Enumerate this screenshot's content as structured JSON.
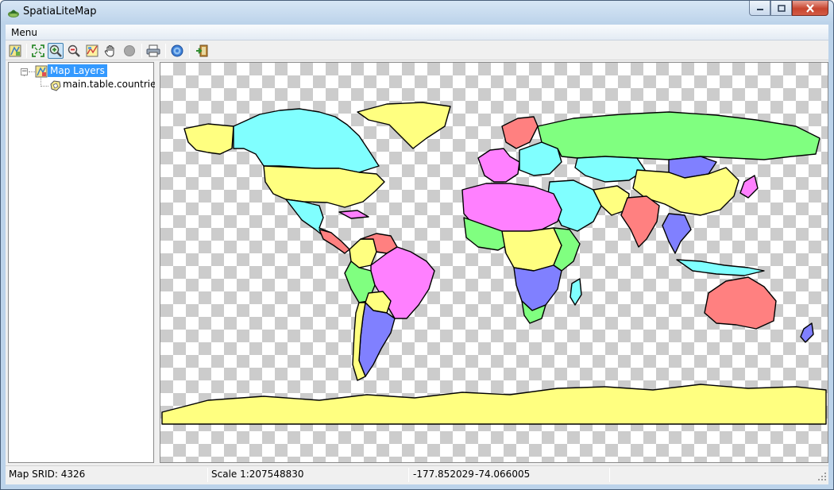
{
  "window": {
    "title": "SpatiaLiteMap"
  },
  "menubar": {
    "menu_label": "Menu"
  },
  "toolbar": {
    "buttons": [
      {
        "icon": "layers-icon"
      },
      {
        "icon": "zoom-extent-icon"
      },
      {
        "icon": "zoom-in-icon",
        "active": true
      },
      {
        "icon": "zoom-out-icon"
      },
      {
        "icon": "map-icon"
      },
      {
        "icon": "pan-hand-icon"
      },
      {
        "icon": "stop-icon"
      },
      {
        "icon": "print-icon"
      },
      {
        "icon": "help-icon"
      },
      {
        "icon": "exit-icon"
      }
    ]
  },
  "tree": {
    "root_label": "Map Layers",
    "child_label": "main.table.countries"
  },
  "statusbar": {
    "srid": "Map SRID: 4326",
    "scale": "Scale 1:207548830",
    "coord_x": "-177.852029",
    "coord_y": "-74.066005"
  },
  "colors": {
    "selection": "#3399ff",
    "fill_yellow": "#ffff80",
    "fill_cyan": "#80ffff",
    "fill_green": "#80ff80",
    "fill_magenta": "#ff80ff",
    "fill_blue": "#8080ff",
    "fill_red": "#ff8080",
    "checker_dark": "#cccccc"
  }
}
